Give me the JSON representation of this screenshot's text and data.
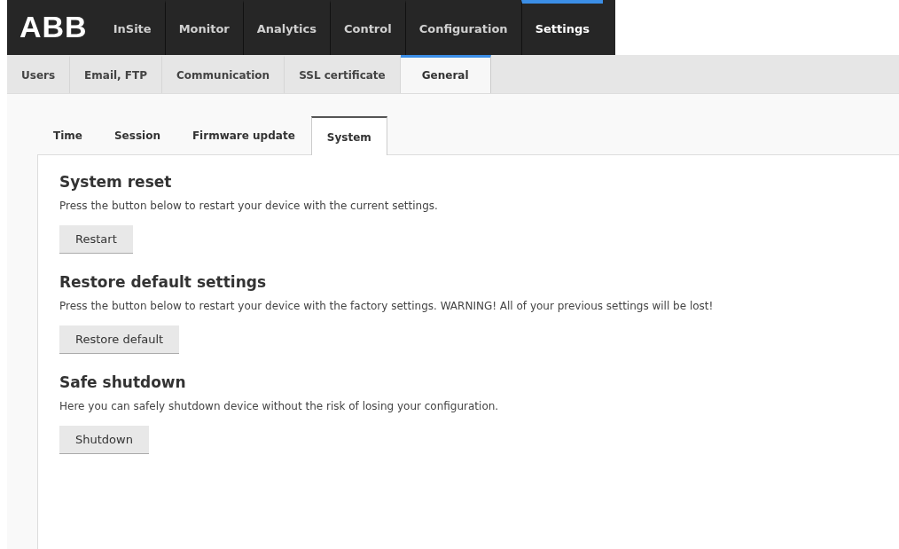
{
  "logo": "ABB",
  "main_nav": [
    {
      "label": "InSite",
      "selected": false
    },
    {
      "label": "Monitor",
      "selected": false
    },
    {
      "label": "Analytics",
      "selected": false
    },
    {
      "label": "Control",
      "selected": false
    },
    {
      "label": "Configuration",
      "selected": false
    },
    {
      "label": "Settings",
      "selected": true
    }
  ],
  "sub_nav": [
    {
      "label": "Users",
      "selected": false
    },
    {
      "label": "Email, FTP",
      "selected": false
    },
    {
      "label": "Communication",
      "selected": false
    },
    {
      "label": "SSL certificate",
      "selected": false
    },
    {
      "label": "General",
      "selected": true
    }
  ],
  "tabs": [
    {
      "label": "Time",
      "selected": false
    },
    {
      "label": "Session",
      "selected": false
    },
    {
      "label": "Firmware update",
      "selected": false
    },
    {
      "label": "System",
      "selected": true
    }
  ],
  "sections": [
    {
      "title": "System reset",
      "description": "Press the button below to restart your device with the current settings.",
      "button": "Restart"
    },
    {
      "title": "Restore default settings",
      "description": "Press the button below to restart your device with the factory settings. WARNING! All of your previous settings will be lost!",
      "button": "Restore default"
    },
    {
      "title": "Safe shutdown",
      "description": "Here you can safely shutdown device without the risk of losing your configuration.",
      "button": "Shutdown"
    }
  ]
}
